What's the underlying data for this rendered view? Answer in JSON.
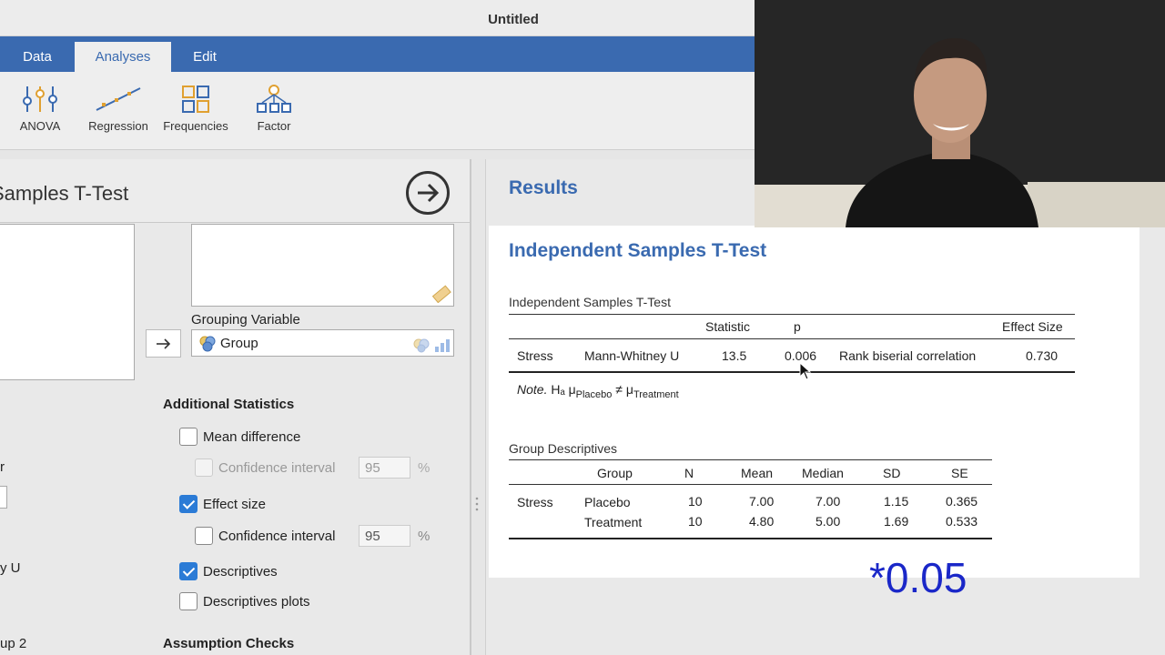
{
  "window": {
    "title": "Untitled"
  },
  "menu": {
    "tabs": [
      {
        "label": "Data"
      },
      {
        "label": "Analyses"
      },
      {
        "label": "Edit"
      }
    ]
  },
  "ribbon": {
    "items": [
      {
        "label": "ANOVA",
        "icon": "anova-icon"
      },
      {
        "label": "Regression",
        "icon": "regression-icon"
      },
      {
        "label": "Frequencies",
        "icon": "frequencies-icon"
      },
      {
        "label": "Factor",
        "icon": "factor-icon"
      }
    ]
  },
  "options": {
    "title": "Samples T-Test",
    "grouping_label": "Grouping Variable",
    "grouping_value": "Group",
    "additional_title": "Additional Statistics",
    "mean_difference": "Mean difference",
    "ci_label": "Confidence interval",
    "ci_value_1": "95",
    "effect_size": "Effect size",
    "ci_value_2": "95",
    "pct": "%",
    "descriptives": "Descriptives",
    "descriptives_plots": "Descriptives plots",
    "assumption_title": "Assumption Checks",
    "left_fragments": [
      "r",
      "y U",
      "up 2"
    ]
  },
  "results": {
    "header": "Results",
    "main_title": "Independent Samples T-Test",
    "ttest_caption": "Independent Samples T-Test",
    "ttest_headers": {
      "statistic": "Statistic",
      "p": "p",
      "effect_size": "Effect Size"
    },
    "ttest_row": {
      "variable": "Stress",
      "test": "Mann-Whitney U",
      "statistic": "13.5",
      "p": "0.006",
      "effect_type": "Rank biserial correlation",
      "effect_value": "0.730"
    },
    "note_label": "Note.",
    "note_text": "Hₐ μ",
    "note_sub1": "Placebo",
    "note_neq": "≠ μ",
    "note_sub2": "Treatment",
    "desc_caption": "Group Descriptives",
    "desc_headers": [
      "Group",
      "N",
      "Mean",
      "Median",
      "SD",
      "SE"
    ],
    "desc_variable": "Stress",
    "desc_rows": [
      {
        "group": "Placebo",
        "n": "10",
        "mean": "7.00",
        "median": "7.00",
        "sd": "1.15",
        "se": "0.365"
      },
      {
        "group": "Treatment",
        "n": "10",
        "mean": "4.80",
        "median": "5.00",
        "sd": "1.69",
        "se": "0.533"
      }
    ]
  },
  "overlay": {
    "text": "*0.05"
  }
}
